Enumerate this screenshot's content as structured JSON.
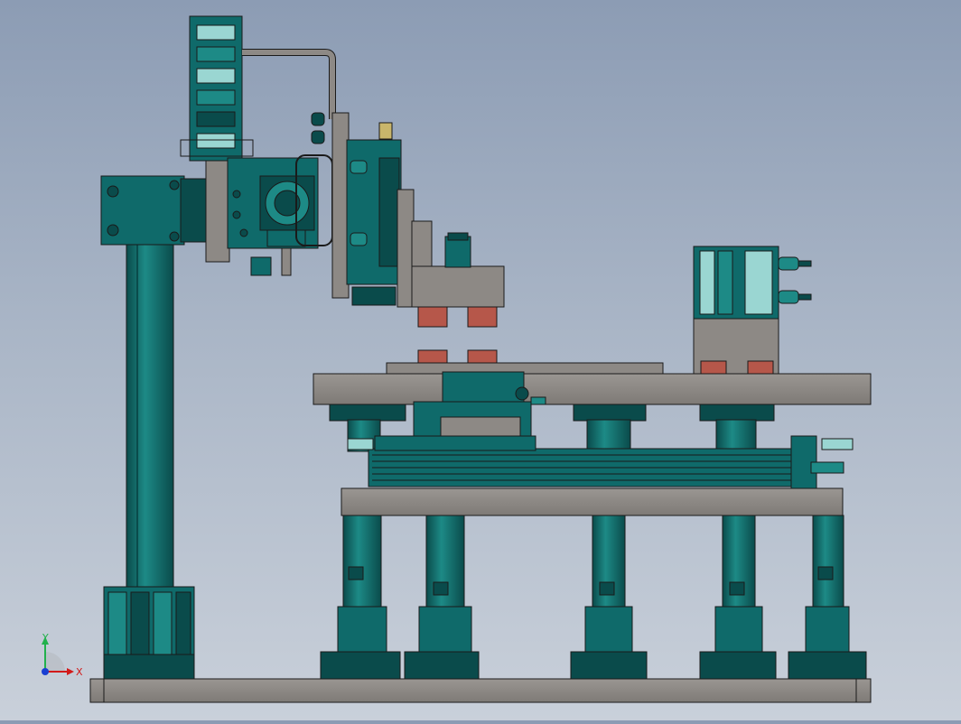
{
  "viewport": {
    "background_top": "#8c9cb4",
    "background_bottom": "#c9d0da"
  },
  "colors": {
    "teal": "#0f6a6a",
    "teal_dark": "#0a4b4b",
    "teal_light": "#1d8a86",
    "steel": "#8d8985",
    "steel_dark": "#6f6b67",
    "copper": "#b6574a",
    "brass": "#c9b66b",
    "outline": "#1a1a1a"
  },
  "triad": {
    "x_label": "X",
    "y_label": "Y",
    "x_color": "#d21a1a",
    "y_color": "#22b14c",
    "z_color": "#1a3fd2"
  }
}
